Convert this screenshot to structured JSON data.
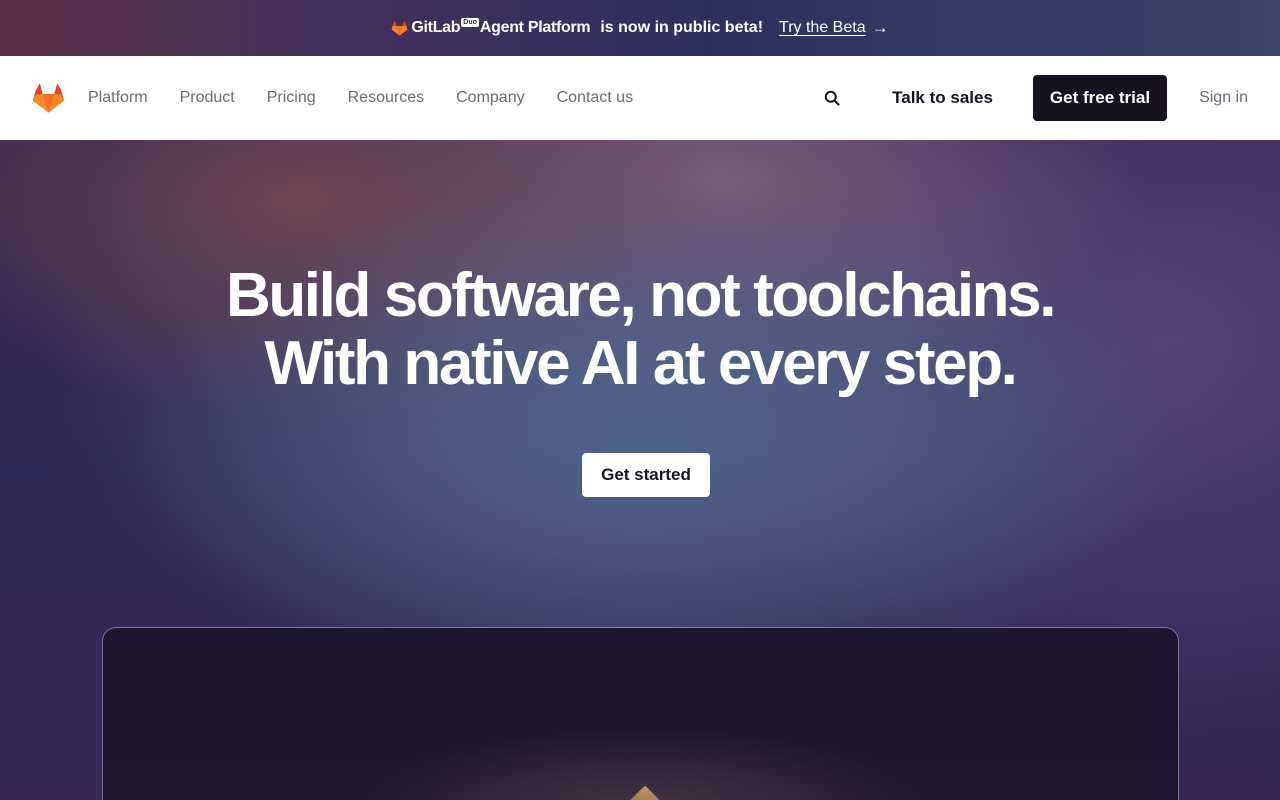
{
  "banner": {
    "brand": "GitLab",
    "duo_tag": "Duo",
    "product": "Agent Platform",
    "message": "is now in public beta!",
    "link_label": "Try the Beta",
    "arrow": "→"
  },
  "nav": {
    "logo_icon": "gitlab-tanuki-icon",
    "links": [
      "Platform",
      "Product",
      "Pricing",
      "Resources",
      "Company",
      "Contact us"
    ],
    "search_icon": "search-icon",
    "talk_to_sales": "Talk to sales",
    "free_trial": "Get free trial",
    "sign_in": "Sign in"
  },
  "hero": {
    "headline_line1": "Build software, not toolchains.",
    "headline_line2": "With native AI at every step.",
    "cta": "Get started"
  },
  "colors": {
    "brand_orange": "#fc6d26",
    "brand_red": "#e24329",
    "brand_amber": "#fca326",
    "dark": "#171321"
  }
}
